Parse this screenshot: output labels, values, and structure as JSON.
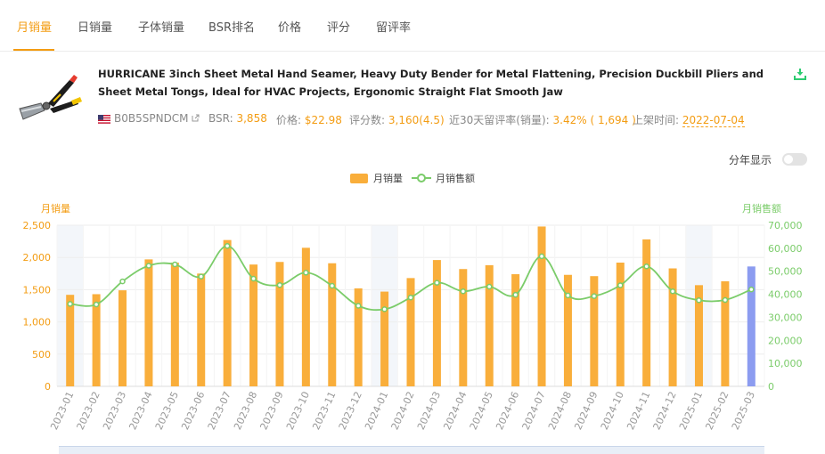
{
  "tabs": [
    {
      "label": "月销量",
      "active": true
    },
    {
      "label": "日销量",
      "active": false
    },
    {
      "label": "子体销量",
      "active": false
    },
    {
      "label": "BSR排名",
      "active": false
    },
    {
      "label": "价格",
      "active": false
    },
    {
      "label": "评分",
      "active": false
    },
    {
      "label": "留评率",
      "active": false
    }
  ],
  "product": {
    "title": "HURRICANE 3inch Sheet Metal Hand Seamer, Heavy Duty Bender for Metal Flattening, Precision Duckbill Pliers and Sheet Metal Tongs, Ideal for HVAC Projects, Ergonomic Straight Flat Smooth Jaw",
    "asin": "B0B5SPNDCM",
    "bsr_label": "BSR:",
    "bsr_value": "3,858",
    "price_label": "价格:",
    "price_value": "$22.98",
    "reviews_label": "评分数:",
    "reviews_value": "3,160(4.5)",
    "review_rate_label": "近30天留评率(销量):",
    "review_rate_value": "3.42% ( 1,694 )",
    "launch_label": "上架时间:",
    "launch_value": "2022-07-04"
  },
  "controls": {
    "year_toggle_label": "分年显示"
  },
  "colors": {
    "accent": "#f39c12",
    "bar": "#f9ae3b",
    "bar_current": "#8c9cf0",
    "line": "#7bcc6a"
  },
  "chart_data": {
    "type": "bar",
    "legend": [
      "月销量",
      "月销售额"
    ],
    "left_axis_title": "月销量",
    "right_axis_title": "月销售额",
    "categories": [
      "2023-01",
      "2023-02",
      "2023-03",
      "2023-04",
      "2023-05",
      "2023-06",
      "2023-07",
      "2023-08",
      "2023-09",
      "2023-10",
      "2023-11",
      "2023-12",
      "2024-01",
      "2024-02",
      "2024-03",
      "2024-04",
      "2024-05",
      "2024-06",
      "2024-07",
      "2024-08",
      "2024-09",
      "2024-10",
      "2024-11",
      "2024-12",
      "2025-01",
      "2025-02",
      "2025-03"
    ],
    "series": [
      {
        "name": "月销量",
        "type": "bar",
        "axis": "left",
        "values": [
          1420,
          1430,
          1490,
          1970,
          1920,
          1750,
          2270,
          1890,
          1930,
          2150,
          1910,
          1520,
          1470,
          1680,
          1960,
          1820,
          1880,
          1740,
          2480,
          1730,
          1710,
          1920,
          2280,
          1830,
          1570,
          1630,
          1860
        ]
      },
      {
        "name": "月销售额",
        "type": "line",
        "axis": "right",
        "values": [
          35800,
          35600,
          45600,
          52400,
          53000,
          47700,
          61000,
          46800,
          44000,
          49400,
          43700,
          35000,
          33500,
          38600,
          45000,
          41300,
          43300,
          39800,
          56500,
          39500,
          39200,
          43900,
          52100,
          41300,
          37400,
          37500,
          42100
        ]
      }
    ],
    "left_ticks": [
      "2,500",
      "2,000",
      "1,500",
      "1,000",
      "500",
      "0"
    ],
    "right_ticks": [
      "70,000",
      "60,000",
      "50,000",
      "40,000",
      "30,000",
      "20,000",
      "10,000",
      "0"
    ],
    "ylim_left": [
      0,
      2500
    ],
    "ylim_right": [
      0,
      70000
    ],
    "year_shading": [
      "2023-01",
      "2024-01",
      "2025-01"
    ],
    "current_month": "2025-03"
  }
}
